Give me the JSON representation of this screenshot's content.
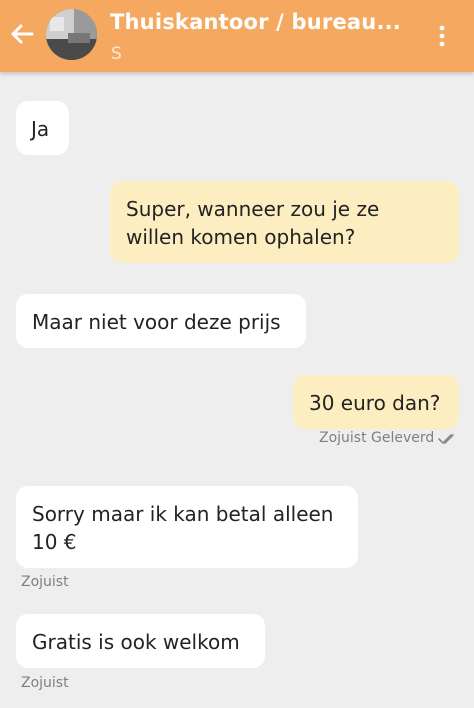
{
  "header": {
    "title": "Thuiskantoor / bureau...",
    "subtitle": "S"
  },
  "messages": [
    {
      "direction": "incoming",
      "text": "Ja"
    },
    {
      "direction": "outgoing",
      "line1": "Super, wanneer zou je ze",
      "line2": "willen komen ophalen?"
    },
    {
      "direction": "incoming",
      "text": "Maar niet voor deze prijs"
    },
    {
      "direction": "outgoing",
      "text": "30 euro dan?",
      "meta": "Zojuist Geleverd"
    },
    {
      "direction": "incoming",
      "line1": "Sorry maar ik kan betal alleen",
      "line2": "10 €",
      "meta": "Zojuist"
    },
    {
      "direction": "incoming",
      "text": "Gratis is ook welkom",
      "meta": "Zojuist"
    }
  ],
  "colors": {
    "appbar": "#f5a860",
    "background": "#efeeee",
    "incoming_bubble": "#ffffff",
    "outgoing_bubble": "#fdeec1"
  },
  "icons": {
    "back": "arrow-left-icon",
    "menu": "more-vertical-icon",
    "delivered": "double-check-icon"
  }
}
